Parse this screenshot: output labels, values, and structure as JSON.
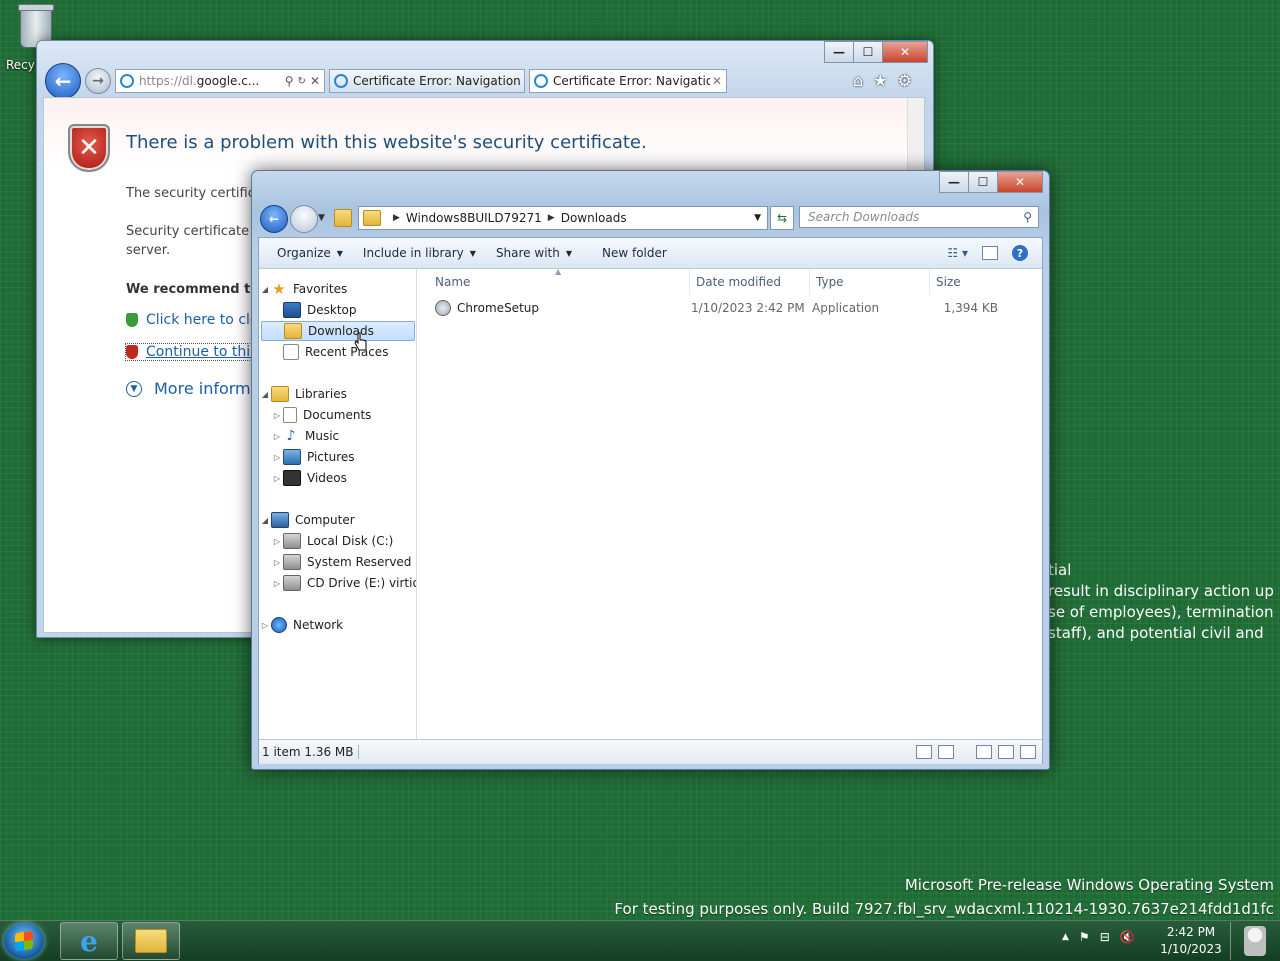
{
  "desktop": {
    "recycle_bin_label": "Recy",
    "background_text": [
      "tial",
      "result in disciplinary action up to",
      "se of employees), termination of",
      "staff), and potential civil and"
    ],
    "watermark_line1": "Microsoft Pre-release Windows Operating System",
    "watermark_line2": "For testing purposes only. Build 7927.fbl_srv_wdacxml.110214-1930.7637e214fdd1d1fc"
  },
  "ie": {
    "address_url_prefix": "https://dl.",
    "address_url_host": "google.c...",
    "tabs": [
      {
        "label": "Certificate Error: Navigation Bl..."
      },
      {
        "label": "Certificate Error: Navigation...",
        "close": "✕"
      }
    ],
    "caption": {
      "minimize": "—",
      "maximize": "☐",
      "close": "✕"
    },
    "page": {
      "title": "There is a problem with this website's security certificate.",
      "text1": "The security certificat",
      "text2a": "Security certificate pr",
      "text2b": "server.",
      "recommend": "We recommend tha",
      "link_close": "Click here to close",
      "link_continue": "Continue to this w",
      "more_info": "More informati"
    }
  },
  "explorer": {
    "caption": {
      "minimize": "—",
      "maximize": "☐",
      "close": "✕"
    },
    "breadcrumb": [
      "Windows8BUILD79271",
      "Downloads"
    ],
    "search_placeholder": "Search Downloads",
    "toolbar": {
      "organize": "Organize",
      "include": "Include in library",
      "share": "Share with",
      "new_folder": "New folder"
    },
    "nav": {
      "favorites": "Favorites",
      "desktop": "Desktop",
      "downloads": "Downloads",
      "recent": "Recent Places",
      "libraries": "Libraries",
      "documents": "Documents",
      "music": "Music",
      "pictures": "Pictures",
      "videos": "Videos",
      "computer": "Computer",
      "local_disk": "Local Disk (C:)",
      "system_reserved": "System Reserved (D:",
      "cd_drive": "CD Drive (E:) virtio-v",
      "network": "Network"
    },
    "columns": {
      "name": "Name",
      "date": "Date modified",
      "type": "Type",
      "size": "Size"
    },
    "files": [
      {
        "name": "ChromeSetup",
        "date": "1/10/2023 2:42 PM",
        "type": "Application",
        "size": "1,394 KB"
      }
    ],
    "status": "1 item 1.36 MB"
  },
  "taskbar": {
    "time": "2:42 PM",
    "date": "1/10/2023"
  }
}
